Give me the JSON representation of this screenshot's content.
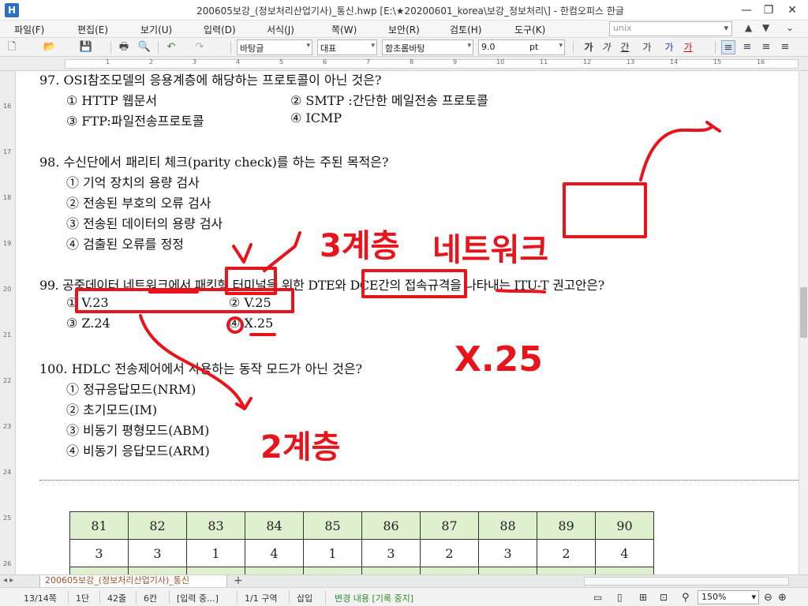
{
  "window": {
    "app_icon": "H",
    "title": "200605보강_(정보처리산업기사)_통신.hwp [E:\\★20200601_korea\\보강_정보처리\\] - 한컴오피스 한글",
    "controls": {
      "minimize": "—",
      "restore": "❐",
      "close": "✕"
    }
  },
  "menu": {
    "items": [
      "파일(F)",
      "편집(E)",
      "보기(U)",
      "입력(D)",
      "서식(J)",
      "쪽(W)",
      "보안(R)",
      "검토(H)",
      "도구(K)"
    ],
    "search_value": "unix",
    "search_arrow": "▾",
    "nav_icons": [
      "▲",
      "▼",
      "⌄"
    ]
  },
  "toolbar": {
    "style_combo": "바탕글",
    "lang_combo": "대표",
    "font_combo": "함초롬바탕",
    "size_value": "9.0",
    "size_unit": "pt",
    "format_buttons": [
      "가",
      "가",
      "간",
      "가",
      "가",
      "가"
    ]
  },
  "ruler": {
    "h_numbers": [
      "1",
      "2",
      "3",
      "4",
      "5",
      "6",
      "7",
      "8",
      "9",
      "10",
      "11",
      "12",
      "13",
      "14",
      "15",
      "16"
    ],
    "v_numbers": [
      "16",
      "17",
      "18",
      "19",
      "20",
      "21",
      "22",
      "23",
      "24",
      "25",
      "26"
    ]
  },
  "document": {
    "q97": {
      "title": "97. OSI참조모델의 응용계층에 해당하는 프로토콜이 아닌 것은?",
      "options": [
        "① HTTP 웹문서",
        "② SMTP :간단한 메일전송 프로토콜",
        "③ FTP:파일전송프로토콜",
        "④ ICMP"
      ]
    },
    "q98": {
      "title": "98. 수신단에서 패리티 체크(parity check)를 하는 주된 목적은?",
      "options": [
        "① 기억 장치의 용량 검사",
        "② 전송된 부호의 오류 검사",
        "③ 전송된 데이터의 용량 검사",
        "④ 검출된 오류를 정정"
      ]
    },
    "q99": {
      "title": "99. 공중데이터 네트워크에서 패킷형 터미널을 위한 DTE와 DCE간의 접속규격을 나타내는 ITU-T 권고안은?",
      "options": [
        "① V.23",
        "② V.25",
        "③ Z.24",
        "④ X.25"
      ]
    },
    "q100": {
      "title": "100. HDLC 전송제어에서 사용하는 동작 모드가 아닌 것은?",
      "options": [
        "① 정규응답모드(NRM)",
        "② 초기모드(IM)",
        "③ 비동기 평형모드(ABM)",
        "④ 비동기 응답모드(ARM)"
      ]
    },
    "answer_table": {
      "headers": [
        "81",
        "82",
        "83",
        "84",
        "85",
        "86",
        "87",
        "88",
        "89",
        "90"
      ],
      "answers": [
        "3",
        "3",
        "1",
        "4",
        "1",
        "3",
        "2",
        "3",
        "2",
        "4"
      ]
    },
    "annotations": {
      "layer3": "3계층",
      "network": "네트워크",
      "x25": "X.25",
      "layer2": "2계층",
      "color": "#e8141c"
    }
  },
  "tabs": {
    "doc_tab": "200605보강_(정보처리산업기사)_통신",
    "add_tab": "+"
  },
  "status": {
    "page": "13/14쪽",
    "column": "1단",
    "line": "42줄",
    "col": "6칸",
    "mode": "[입력 중...]",
    "section": "1/1 구역",
    "insert": "삽입",
    "track": "변경 내용 [기록 중지]",
    "zoom": "150%",
    "zoom_minus": "⊖",
    "zoom_plus": "⊕"
  },
  "colors": {
    "accent": "#2d6fc3",
    "table_header": "#dff0cf",
    "annotation": "#e8141c"
  }
}
